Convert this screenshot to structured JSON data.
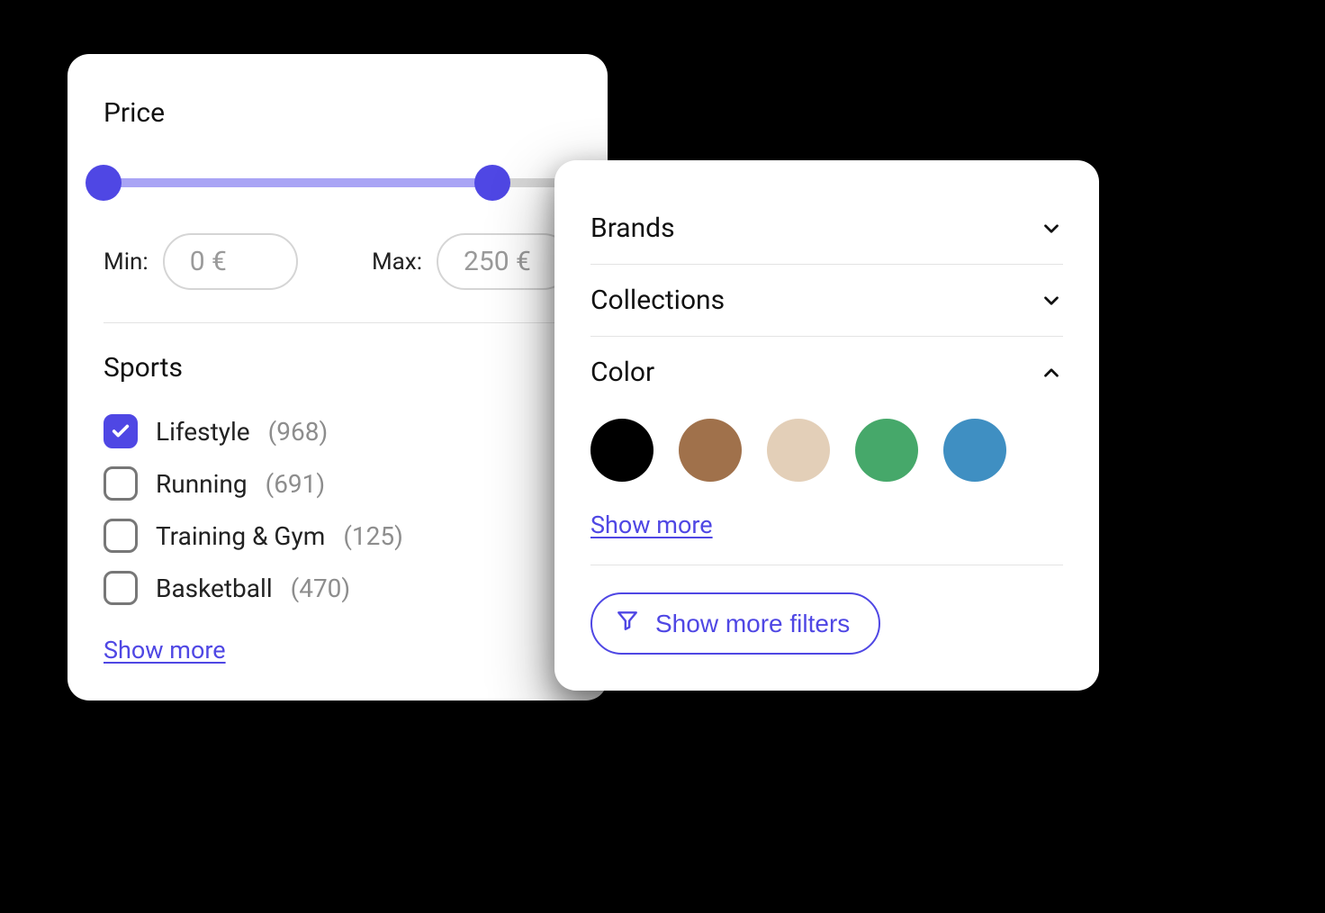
{
  "accent": "#4f47e4",
  "left": {
    "price": {
      "title": "Price",
      "min_label": "Min:",
      "max_label": "Max:",
      "min_value": "0 €",
      "max_value": "250 €"
    },
    "sports": {
      "title": "Sports",
      "items": [
        {
          "label": "Lifestyle",
          "count": "(968)",
          "checked": true
        },
        {
          "label": "Running",
          "count": "(691)",
          "checked": false
        },
        {
          "label": "Training & Gym",
          "count": "(125)",
          "checked": false
        },
        {
          "label": "Basketball",
          "count": "(470)",
          "checked": false
        }
      ],
      "show_more": "Show more"
    }
  },
  "right": {
    "brands": {
      "title": "Brands"
    },
    "collections": {
      "title": "Collections"
    },
    "color": {
      "title": "Color",
      "swatches": [
        "#000000",
        "#a0714b",
        "#e3cfb8",
        "#46a86a",
        "#3f8fc2"
      ],
      "show_more": "Show more"
    },
    "show_more_filters": "Show more filters"
  }
}
